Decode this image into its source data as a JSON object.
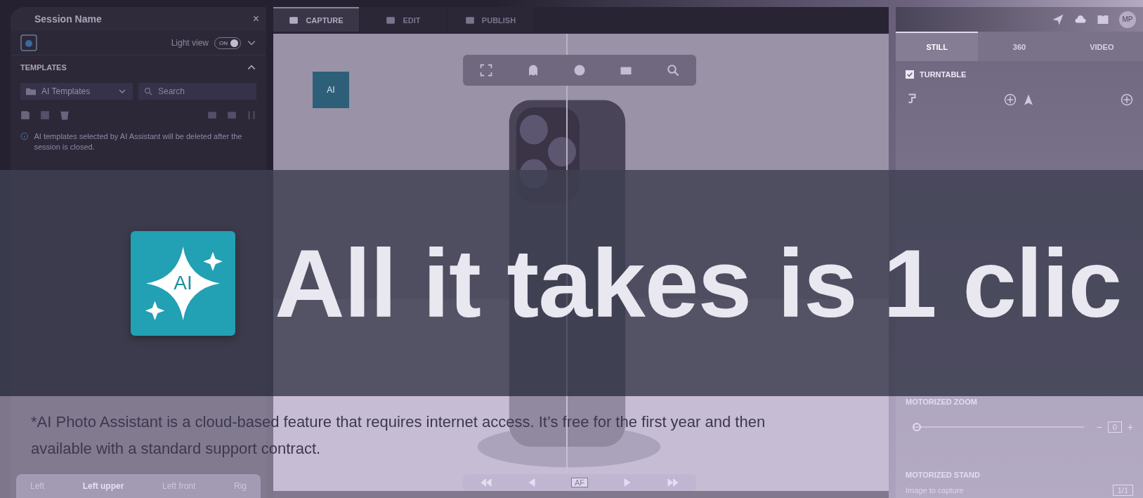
{
  "left_panel": {
    "title": "Session Name",
    "close": "×",
    "light_view": {
      "label": "Light view",
      "toggle": "ON",
      "on": true
    },
    "templates": {
      "heading": "TEMPLATES",
      "folder": "AI Templates",
      "search": {
        "placeholder": "Search"
      },
      "info": "AI templates selected by AI Assistant will be deleted after the session is closed."
    },
    "light_zone": {
      "options": [
        {
          "label": "Left",
          "selected": false
        },
        {
          "label": "Left upper",
          "selected": true
        },
        {
          "label": "Left front",
          "selected": false
        },
        {
          "label": "Rig",
          "selected": false
        }
      ]
    }
  },
  "center": {
    "tabs": [
      {
        "label": "CAPTURE",
        "selected": true
      },
      {
        "label": "EDIT",
        "selected": false
      },
      {
        "label": "PUBLISH",
        "selected": false
      }
    ],
    "ai_badge": "AI",
    "playback": {
      "af": "AF"
    }
  },
  "right_panel": {
    "avatar": "MP",
    "tabs": [
      {
        "label": "STILL",
        "selected": true
      },
      {
        "label": "360",
        "selected": false
      },
      {
        "label": "VIDEO",
        "selected": false
      }
    ],
    "turntable": {
      "label": "TURNTABLE",
      "checked": true
    },
    "zoom": {
      "heading": "MOTORIZED ZOOM",
      "level": 0,
      "value": "0",
      "minus": "−",
      "plus": "+"
    },
    "stand": {
      "heading": "MOTORIZED STAND",
      "label": "Image to capture",
      "value": "1/1"
    }
  },
  "banner": {
    "logo_text": "AI",
    "headline": "All it takes is 1 clic",
    "footnote": "*AI Photo Assistant is a cloud-based feature that requires internet access. It’s free for the first year and then available with a standard support contract."
  }
}
